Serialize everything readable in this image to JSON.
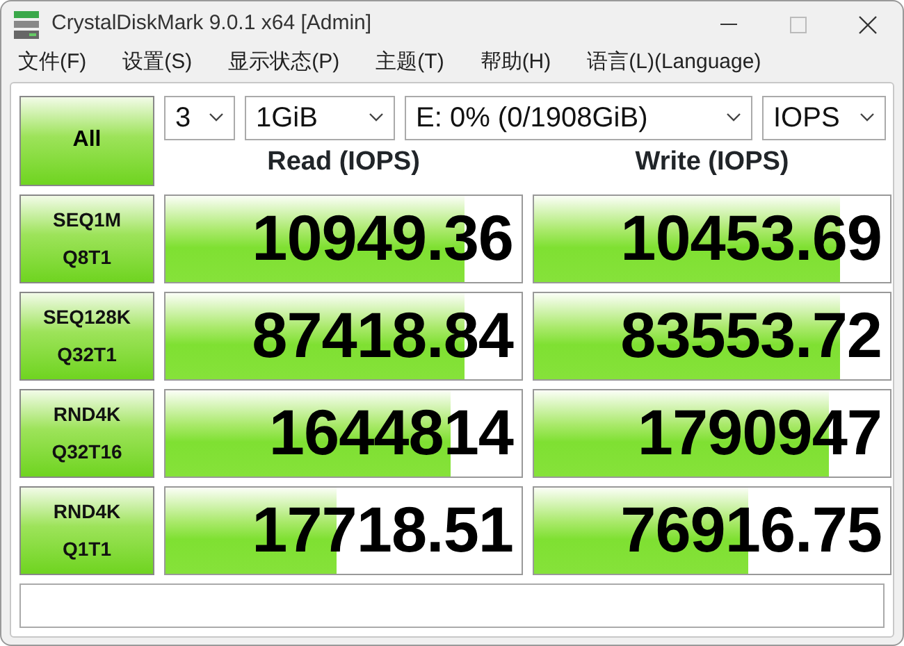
{
  "window": {
    "title": "CrystalDiskMark 9.0.1 x64 [Admin]"
  },
  "menu": [
    "文件(F)",
    "设置(S)",
    "显示状态(P)",
    "主题(T)",
    "帮助(H)",
    "语言(L)(Language)"
  ],
  "all_button": "All",
  "selectors": [
    {
      "value": "3"
    },
    {
      "value": "1GiB"
    },
    {
      "value": "E: 0% (0/1908GiB)"
    },
    {
      "value": "IOPS"
    }
  ],
  "columns": [
    "Read (IOPS)",
    "Write (IOPS)"
  ],
  "tests": [
    {
      "label": [
        "SEQ1M",
        "Q8T1"
      ],
      "read": {
        "value": "10949.36",
        "level": 0.84
      },
      "write": {
        "value": "10453.69",
        "level": 0.86
      }
    },
    {
      "label": [
        "SEQ128K",
        "Q32T1"
      ],
      "read": {
        "value": "87418.84",
        "level": 0.84
      },
      "write": {
        "value": "83553.72",
        "level": 0.86
      }
    },
    {
      "label": [
        "RND4K",
        "Q32T16"
      ],
      "read": {
        "value": "1644814",
        "level": 0.8
      },
      "write": {
        "value": "1790947",
        "level": 0.83
      }
    },
    {
      "label": [
        "RND4K",
        "Q1T1"
      ],
      "read": {
        "value": "17718.51",
        "level": 0.48
      },
      "write": {
        "value": "76916.75",
        "level": 0.6
      }
    }
  ]
}
